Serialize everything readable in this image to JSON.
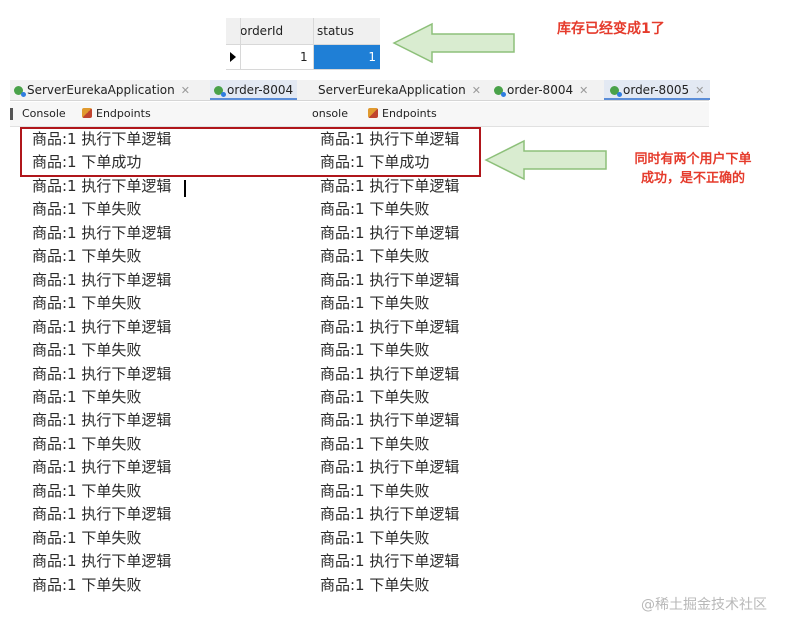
{
  "db_table": {
    "headers": [
      "orderId",
      "status"
    ],
    "row": {
      "orderId": "1",
      "status": "1"
    }
  },
  "annotations": {
    "top_note": "库存已经变成1了",
    "side_note_line1": "同时有两个用户下单",
    "side_note_line2": "成功，是不正确的"
  },
  "left_panel": {
    "tabs": [
      {
        "label": "ServerEurekaApplication",
        "active": false
      },
      {
        "label": "order-8004",
        "active": true
      }
    ],
    "toolbar": {
      "console": "Console",
      "endpoints": "Endpoints"
    },
    "log": [
      "商品:1 执行下单逻辑",
      "商品:1 下单成功",
      "商品:1 执行下单逻辑",
      "商品:1 下单失败",
      "商品:1 执行下单逻辑",
      "商品:1 下单失败",
      "商品:1 执行下单逻辑",
      "商品:1 下单失败",
      "商品:1 执行下单逻辑",
      "商品:1 下单失败",
      "商品:1 执行下单逻辑",
      "商品:1 下单失败",
      "商品:1 执行下单逻辑",
      "商品:1 下单失败",
      "商品:1 执行下单逻辑",
      "商品:1 下单失败",
      "商品:1 执行下单逻辑",
      "商品:1 下单失败",
      "商品:1 执行下单逻辑",
      "商品:1 下单失败"
    ]
  },
  "right_panel": {
    "tabs": [
      {
        "label": "ServerEurekaApplication",
        "active": false
      },
      {
        "label": "order-8004",
        "active": false
      },
      {
        "label": "order-8005",
        "active": true
      }
    ],
    "toolbar": {
      "console": "onsole",
      "endpoints": "Endpoints"
    },
    "log": [
      "商品:1 执行下单逻辑",
      "商品:1 下单成功",
      "商品:1 执行下单逻辑",
      "商品:1 下单失败",
      "商品:1 执行下单逻辑",
      "商品:1 下单失败",
      "商品:1 执行下单逻辑",
      "商品:1 下单失败",
      "商品:1 执行下单逻辑",
      "商品:1 下单失败",
      "商品:1 执行下单逻辑",
      "商品:1 下单失败",
      "商品:1 执行下单逻辑",
      "商品:1 下单失败",
      "商品:1 执行下单逻辑",
      "商品:1 下单失败",
      "商品:1 执行下单逻辑",
      "商品:1 下单失败",
      "商品:1 执行下单逻辑",
      "商品:1 下单失败"
    ]
  },
  "watermark": "@稀土掘金技术社区",
  "colors": {
    "highlight": "#b0161b",
    "annotation": "#e53b2c",
    "selection": "#1f7fd6",
    "arrow_fill": "#d9ecd0"
  }
}
